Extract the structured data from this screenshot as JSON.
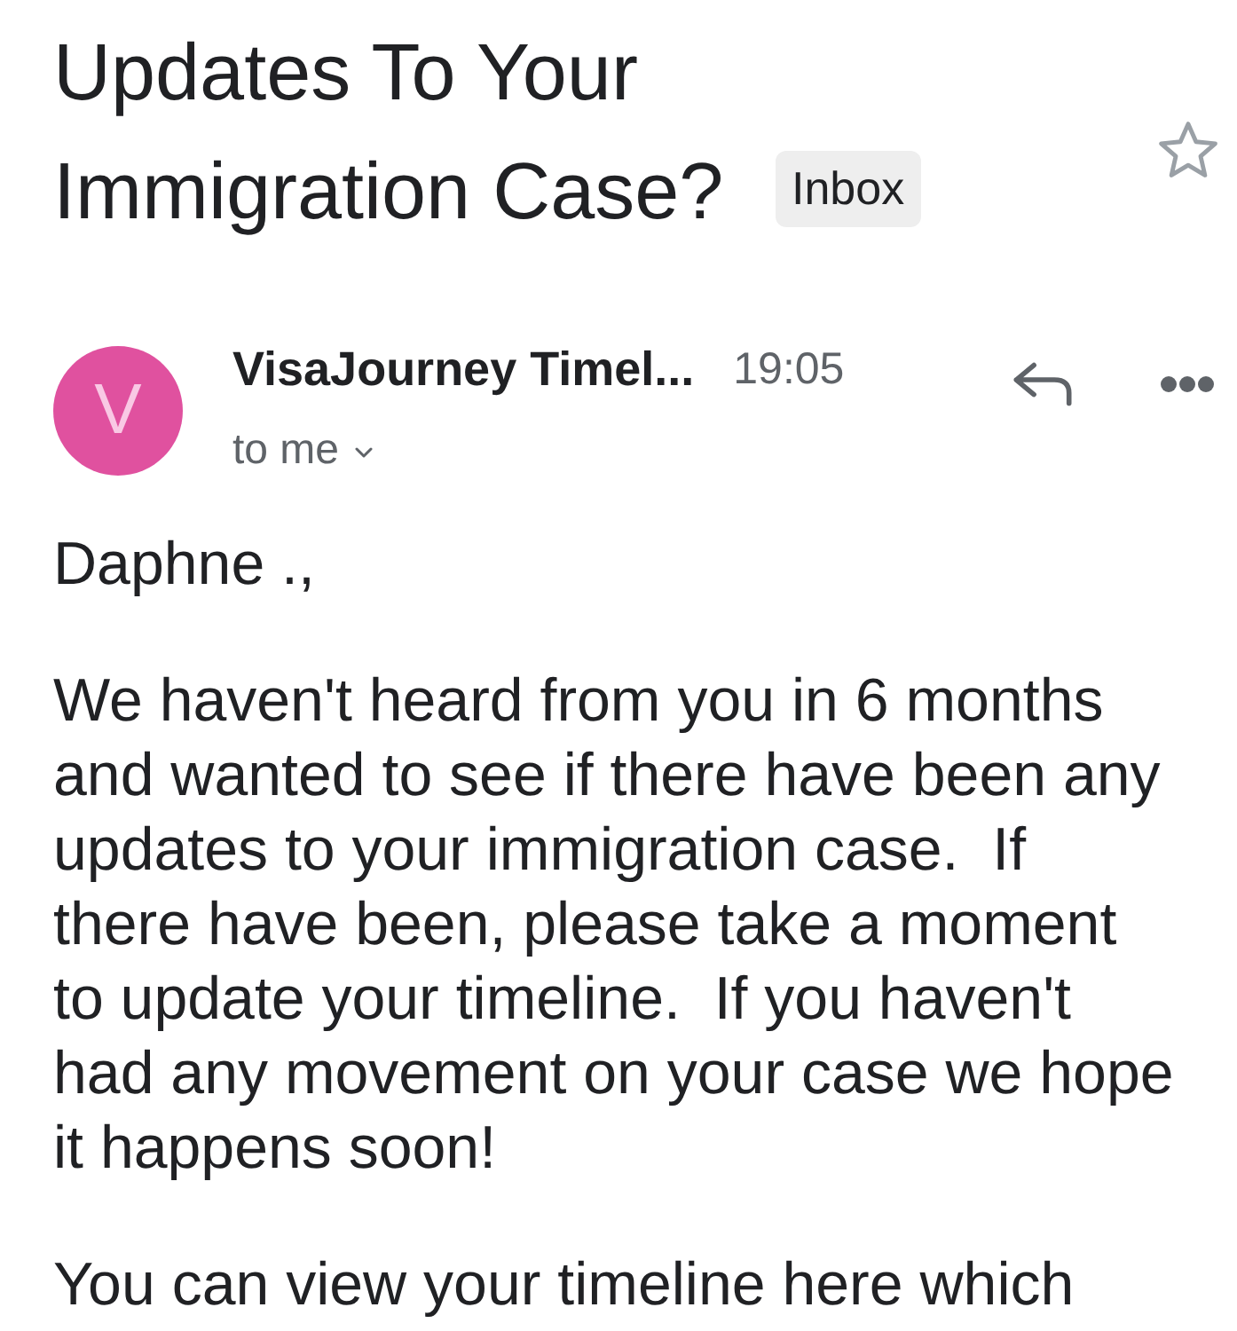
{
  "subject": {
    "title": "Updates To Your Immigration Case?",
    "label": "Inbox",
    "starred": false
  },
  "message": {
    "sender": {
      "initial": "V",
      "name": "VisaJourney Timel..."
    },
    "time": "19:05",
    "recipient": "to me"
  },
  "body": {
    "paragraphs": [
      "Daphne .,",
      "We haven't heard from you in 6 months\nand wanted to see if there have been any\nupdates to your immigration case.  If\nthere have been, please take a moment\nto update your timeline.  If you haven't\nhad any movement on your case we hope\nit happens soon!",
      "You can view your timeline here which"
    ]
  }
}
